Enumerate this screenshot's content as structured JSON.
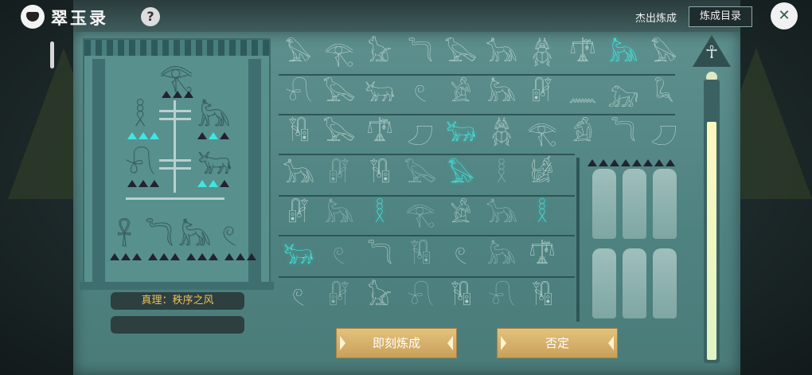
{
  "app": {
    "title": "翠玉录",
    "help": "?"
  },
  "header": {
    "top_link": "杰出炼成",
    "catalog_button": "炼成目录",
    "close_icon": "✕"
  },
  "shrine": {
    "top_glyph": "𓂀",
    "left_glyphs": [
      "𓆓",
      "𓅃",
      "𓋹",
      "𓂀"
    ],
    "mid_glyphs": {
      "left1": "𓎛",
      "right1": "𓃦",
      "left2": "𓍯",
      "right2": "𓃒"
    },
    "bottom_glyphs": [
      "𓋹",
      "𓆓",
      "𓃦",
      "𓏲"
    ],
    "truth_label": "真理：秩序之风"
  },
  "grid": {
    "rows": [
      [
        "𓅃",
        "𓂀",
        "𓃠",
        "𓆓",
        "𓅂",
        "𓃥",
        "𓆣",
        "𓍝",
        "𓃦",
        "𓅃"
      ],
      [
        "𓍯",
        "𓅂",
        "𓃒",
        "𓏲",
        "𓀀",
        "𓃦",
        "𓏞",
        "𓈖",
        "𓃷",
        "𓆗"
      ],
      [
        "𓏟",
        "𓅂",
        "𓍝",
        "𓈔",
        "𓃒",
        "𓆣",
        "𓂀",
        "𓀁",
        "𓆓",
        "𓈔"
      ],
      [
        "𓃥",
        "𓏞",
        "𓏟",
        "𓅂",
        "𓅃",
        "𓎛",
        "𓀎"
      ],
      [
        "𓏞",
        "𓃦",
        "𓎛",
        "𓂀",
        "𓀀",
        "𓃥",
        "𓎛"
      ],
      [
        "𓃒",
        "𓏲",
        "𓆓",
        "𓏟",
        "𓏲",
        "𓃦",
        "𓍝"
      ],
      [
        "𓏲",
        "𓏞",
        "𓃠",
        "𓍯",
        "𓏟",
        "𓍯",
        "𓏟"
      ]
    ],
    "lit": [
      [
        0,
        8
      ],
      [
        2,
        4
      ],
      [
        3,
        4
      ],
      [
        4,
        2
      ],
      [
        4,
        6
      ],
      [
        5,
        0
      ]
    ]
  },
  "gauge": {
    "fill_fraction": 0.86,
    "ankh": "☥"
  },
  "buttons": {
    "confirm": "即刻炼成",
    "deny": "否定"
  }
}
